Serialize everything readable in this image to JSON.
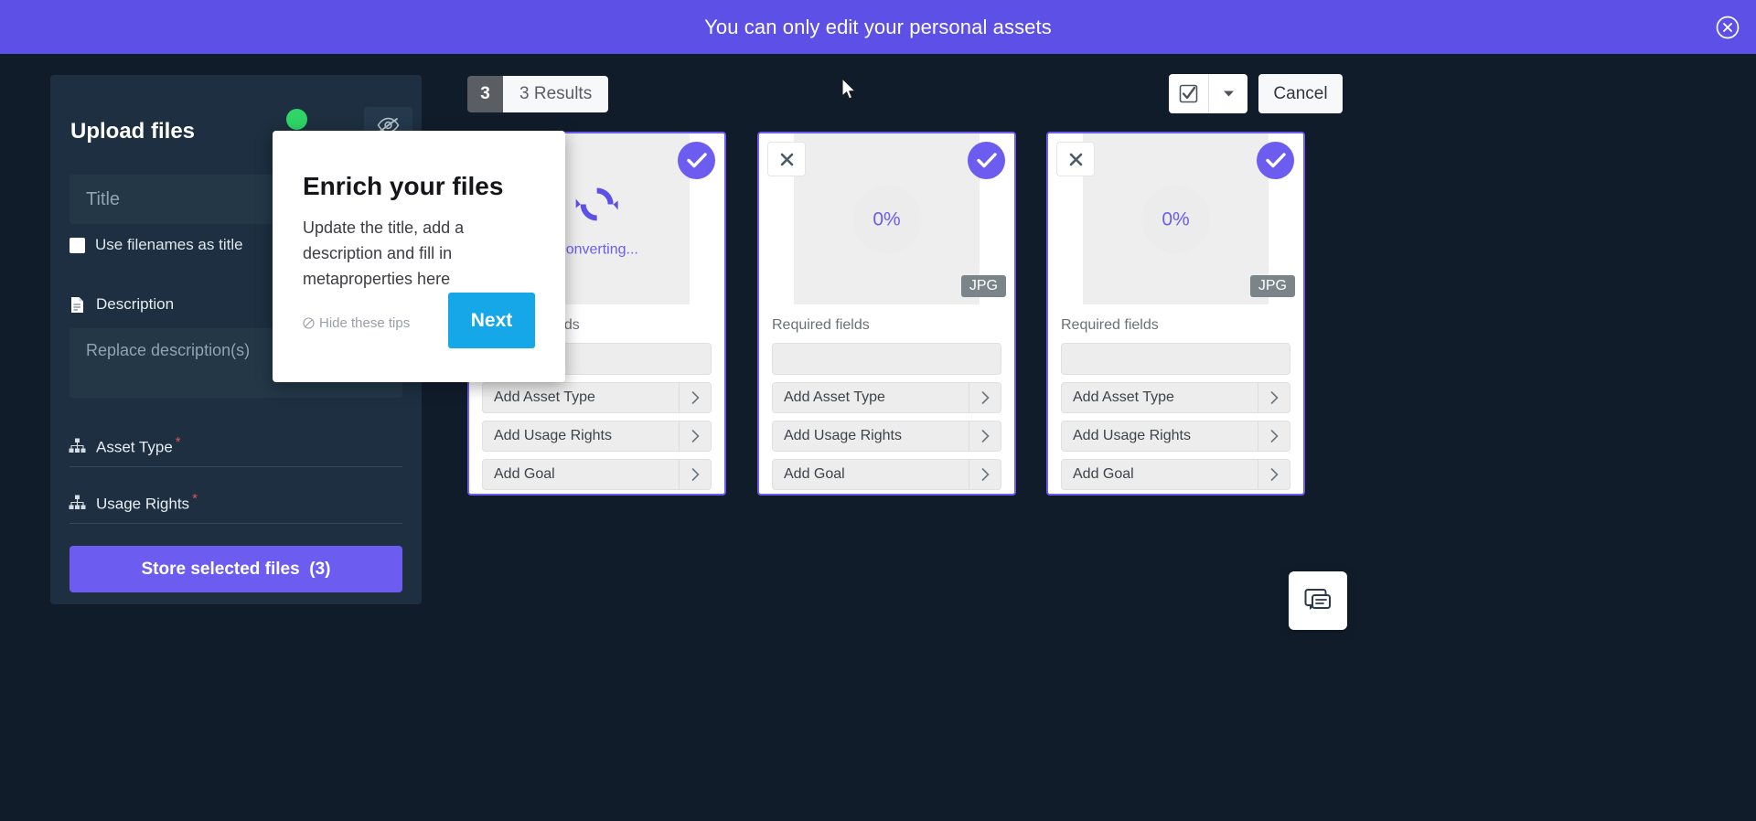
{
  "banner": {
    "message": "You can only edit your personal assets",
    "close_icon": "close-circle-icon",
    "bg_color": "#5d50e6"
  },
  "left_panel": {
    "title": "Upload files",
    "status_dot_color": "#2fd566",
    "hide_icon": "eye-off-icon",
    "title_input": {
      "placeholder": "Title",
      "value": ""
    },
    "use_filenames_checkbox": {
      "label": "Use filenames as title",
      "checked": false
    },
    "description_section": {
      "icon": "document-icon",
      "label": "Description",
      "input_placeholder": "Replace description(s)",
      "input_value": ""
    },
    "asset_type_section": {
      "icon": "hierarchy-icon",
      "label": "Asset Type",
      "required_marker": "*"
    },
    "usage_rights_section": {
      "icon": "hierarchy-icon",
      "label": "Usage Rights",
      "required_marker": "*"
    },
    "store_button": {
      "label": "Store selected files",
      "count": "(3)",
      "color": "#6c5cf0"
    }
  },
  "tooltip": {
    "title": "Enrich your files",
    "body": "Update the title, add a description and fill in metaproperties here",
    "hide_link": "Hide these tips",
    "hide_icon": "no-entry-icon",
    "next_button": "Next",
    "next_color": "#16a7e8"
  },
  "toolbar": {
    "results_count": "3",
    "results_label": "3 Results",
    "select_all_icon": "checkbox-checked-icon",
    "dropdown_icon": "chevron-down-icon",
    "cancel_button": "Cancel"
  },
  "cards": [
    {
      "state": "converting",
      "status_label": "Converting...",
      "status_icon": "sync-arrows-icon",
      "selected": true,
      "check_icon": "check-icon",
      "remove_icon": "close-icon",
      "extension": "",
      "required_fields_label": "Required fields",
      "title_input_value": "",
      "actions": [
        {
          "label": "Add Asset Type",
          "chevron": "chevron-right-icon"
        },
        {
          "label": "Add Usage Rights",
          "chevron": "chevron-right-icon"
        },
        {
          "label": "Add Goal",
          "chevron": "chevron-right-icon"
        }
      ]
    },
    {
      "state": "uploading",
      "progress": "0%",
      "selected": true,
      "check_icon": "check-icon",
      "remove_icon": "close-icon",
      "extension": "JPG",
      "required_fields_label": "Required fields",
      "title_input_value": "",
      "actions": [
        {
          "label": "Add Asset Type",
          "chevron": "chevron-right-icon"
        },
        {
          "label": "Add Usage Rights",
          "chevron": "chevron-right-icon"
        },
        {
          "label": "Add Goal",
          "chevron": "chevron-right-icon"
        }
      ]
    },
    {
      "state": "uploading",
      "progress": "0%",
      "selected": true,
      "check_icon": "check-icon",
      "remove_icon": "close-icon",
      "extension": "JPG",
      "required_fields_label": "Required fields",
      "title_input_value": "",
      "actions": [
        {
          "label": "Add Asset Type",
          "chevron": "chevron-right-icon"
        },
        {
          "label": "Add Usage Rights",
          "chevron": "chevron-right-icon"
        },
        {
          "label": "Add Goal",
          "chevron": "chevron-right-icon"
        }
      ]
    }
  ],
  "chat_widget": {
    "icon": "chat-bubble-icon"
  }
}
